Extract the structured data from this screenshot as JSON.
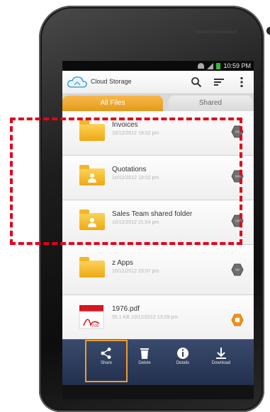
{
  "status_bar": {
    "time": "10:59 PM"
  },
  "app": {
    "title": "Cloud Storage"
  },
  "tabs": [
    {
      "label": "All Files"
    },
    {
      "label": "Shared"
    }
  ],
  "files": [
    {
      "name": "Invoices",
      "meta": "10/12/2012 19:02 pm",
      "icon": "folder-icon",
      "button": "gray"
    },
    {
      "name": "Quotations",
      "meta": "10/12/2012 19:02 pm",
      "icon": "shared-folder-icon",
      "button": "gray"
    },
    {
      "name": "Sales Team shared folder",
      "meta": "10/12/2012 21:54 pm",
      "icon": "shared-folder-icon",
      "button": "gray"
    },
    {
      "name": "z Apps",
      "meta": "10/12/2012 23:07 pm",
      "icon": "folder-icon",
      "button": "gray"
    },
    {
      "name": "1976.pdf",
      "meta": "55.1 KB 10/12/2012 13:09 pm",
      "icon": "pdf-file-icon",
      "button": "orange"
    }
  ],
  "actions": [
    {
      "label": "Share",
      "icon": "share-icon"
    },
    {
      "label": "Delete",
      "icon": "trash-icon"
    },
    {
      "label": "Details",
      "icon": "info-icon"
    },
    {
      "label": "Download",
      "icon": "download-icon"
    }
  ],
  "colors": {
    "accent": "#e39a1c",
    "action_bar": "#2b3a5c",
    "highlight": "#e3001b",
    "share_outline": "#f29b2b"
  }
}
